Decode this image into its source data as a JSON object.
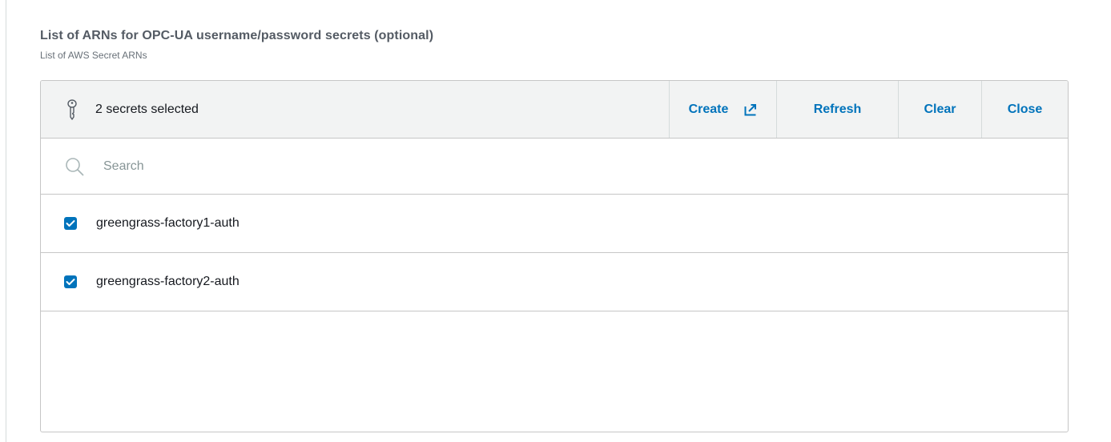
{
  "field": {
    "label": "List of ARNs for OPC-UA username/password secrets (optional)",
    "description": "List of AWS Secret ARNs"
  },
  "header": {
    "selected_text": "2 secrets selected",
    "icon": "key-icon",
    "buttons": {
      "create": "Create",
      "refresh": "Refresh",
      "clear": "Clear",
      "close": "Close"
    }
  },
  "search": {
    "placeholder": "Search",
    "value": ""
  },
  "options": [
    {
      "label": "greengrass-factory1-auth",
      "checked": true
    },
    {
      "label": "greengrass-factory2-auth",
      "checked": true
    }
  ],
  "colors": {
    "accent": "#0073bb",
    "header_bg": "#f2f3f3",
    "border": "#c6c6c6"
  }
}
